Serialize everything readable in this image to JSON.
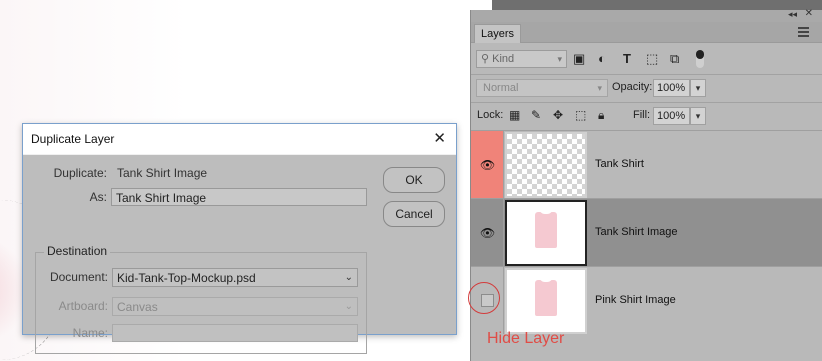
{
  "layers_panel": {
    "tab_label": "Layers",
    "filter": {
      "placeholder": "Kind"
    },
    "blend_mode": "Normal",
    "opacity_label": "Opacity:",
    "opacity_value": "100%",
    "lock_label": "Lock:",
    "fill_label": "Fill:",
    "fill_value": "100%",
    "layers": [
      {
        "name": "Tank Shirt",
        "visible": true,
        "thumbnail": "transparent"
      },
      {
        "name": "Tank Shirt Image",
        "visible": true,
        "thumbnail": "shirt",
        "selected": true
      },
      {
        "name": "Pink Shirt Image",
        "visible": false,
        "thumbnail": "shirt"
      }
    ]
  },
  "annotation": {
    "hide_layer_label": "Hide Layer",
    "color": "#e04c46"
  },
  "dialog": {
    "title": "Duplicate Layer",
    "duplicate_label": "Duplicate:",
    "duplicate_value": "Tank Shirt Image",
    "as_label": "As:",
    "as_value": "Tank Shirt Image",
    "destination_title": "Destination",
    "document_label": "Document:",
    "document_value": "Kid-Tank-Top-Mockup.psd",
    "artboard_label": "Artboard:",
    "artboard_value": "Canvas",
    "name_label": "Name:",
    "name_value": "",
    "ok_label": "OK",
    "cancel_label": "Cancel"
  },
  "colors": {
    "eye_highlight": "#f08379",
    "selected_layer": "#909090"
  }
}
